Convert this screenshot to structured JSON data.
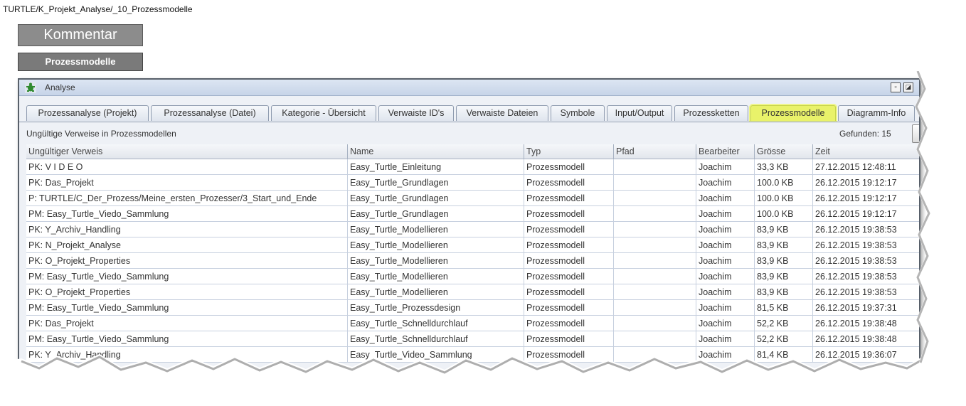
{
  "breadcrumb": "TURTLE/K_Projekt_Analyse/_10_Prozessmodelle",
  "buttons": {
    "kommentar": "Kommentar",
    "prozessmodelle": "Prozessmodelle"
  },
  "window": {
    "title": "Analyse",
    "app_icon": "turtle-icon",
    "minimize_icon": "restore-icon",
    "maximize_icon": "maximize-icon"
  },
  "tabs": [
    "Prozessanalyse (Projekt)",
    "Prozessanalyse (Datei)",
    "Kategorie - Übersicht",
    "Verwaiste ID's",
    "Verwaiste Dateien",
    "Symbole",
    "Input/Output",
    "Prozessketten",
    "Prozessmodelle",
    "Diagramm-Info"
  ],
  "active_tab": "Prozessmodelle",
  "active_tab_color": "#e9f26a",
  "subheading": "Ungültige Verweise in Prozessmodellen",
  "found_text": "Gefunden: 15",
  "found_button_icon": "arrow-right-icon",
  "columns": [
    "Ungültiger Verweis",
    "Name",
    "Typ",
    "Pfad",
    "Bearbeiter",
    "Grösse",
    "Zeit"
  ],
  "rows": [
    [
      "PK: V I D E O",
      "Easy_Turtle_Einleitung",
      "Prozessmodell",
      "",
      "Joachim",
      "33,3 KB",
      "27.12.2015 12:48:11"
    ],
    [
      "PK: Das_Projekt",
      "Easy_Turtle_Grundlagen",
      "Prozessmodell",
      "",
      "Joachim",
      "100.0 KB",
      "26.12.2015 19:12:17"
    ],
    [
      "P: TURTLE/C_Der_Prozess/Meine_ersten_Prozesser/3_Start_und_Ende",
      "Easy_Turtle_Grundlagen",
      "Prozessmodell",
      "",
      "Joachim",
      "100.0 KB",
      "26.12.2015 19:12:17"
    ],
    [
      "PM: Easy_Turtle_Viedo_Sammlung",
      "Easy_Turtle_Grundlagen",
      "Prozessmodell",
      "",
      "Joachim",
      "100.0 KB",
      "26.12.2015 19:12:17"
    ],
    [
      "PK: Y_Archiv_Handling",
      "Easy_Turtle_Modellieren",
      "Prozessmodell",
      "",
      "Joachim",
      "83,9 KB",
      "26.12.2015 19:38:53"
    ],
    [
      "PK: N_Projekt_Analyse",
      "Easy_Turtle_Modellieren",
      "Prozessmodell",
      "",
      "Joachim",
      "83,9 KB",
      "26.12.2015 19:38:53"
    ],
    [
      "PK: O_Projekt_Properties",
      "Easy_Turtle_Modellieren",
      "Prozessmodell",
      "",
      "Joachim",
      "83,9 KB",
      "26.12.2015 19:38:53"
    ],
    [
      "PM: Easy_Turtle_Viedo_Sammlung",
      "Easy_Turtle_Modellieren",
      "Prozessmodell",
      "",
      "Joachim",
      "83,9 KB",
      "26.12.2015 19:38:53"
    ],
    [
      "PK: O_Projekt_Properties",
      "Easy_Turtle_Modellieren",
      "Prozessmodell",
      "",
      "Joachim",
      "83,9 KB",
      "26.12.2015 19:38:53"
    ],
    [
      "PM: Easy_Turtle_Viedo_Sammlung",
      "Easy_Turtle_Prozessdesign",
      "Prozessmodell",
      "",
      "Joachim",
      "81,5 KB",
      "26.12.2015 19:37:31"
    ],
    [
      "PK: Das_Projekt",
      "Easy_Turtle_Schnelldurchlauf",
      "Prozessmodell",
      "",
      "Joachim",
      "52,2 KB",
      "26.12.2015 19:38:48"
    ],
    [
      "PM: Easy_Turtle_Viedo_Sammlung",
      "Easy_Turtle_Schnelldurchlauf",
      "Prozessmodell",
      "",
      "Joachim",
      "52,2 KB",
      "26.12.2015 19:38:48"
    ],
    [
      "PK: Y_Archiv_Handling",
      "Easy_Turtle_Video_Sammlung",
      "Prozessmodell",
      "",
      "Joachim",
      "81,4 KB",
      "26.12.2015 19:36:07"
    ]
  ]
}
